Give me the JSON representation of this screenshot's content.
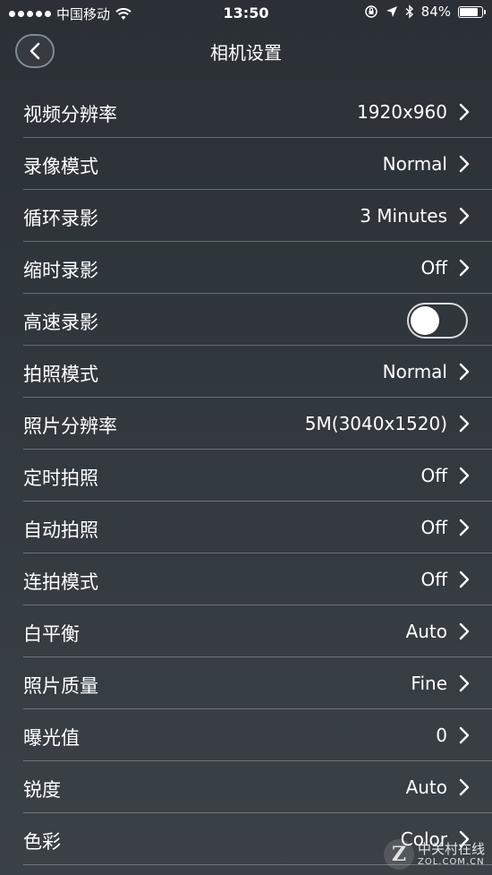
{
  "status_bar": {
    "carrier": "中国移动",
    "time": "13:50",
    "battery": "84%",
    "battery_level": 0.84
  },
  "header": {
    "title": "相机设置"
  },
  "settings": [
    {
      "label": "视频分辨率",
      "value": "1920x960"
    },
    {
      "label": "录像模式",
      "value": "Normal"
    },
    {
      "label": "循环录影",
      "value": "3 Minutes"
    },
    {
      "label": "缩时录影",
      "value": "Off"
    },
    {
      "label": "高速录影",
      "toggle": false
    },
    {
      "label": "拍照模式",
      "value": "Normal"
    },
    {
      "label": "照片分辨率",
      "value": "5M(3040x1520)"
    },
    {
      "label": "定时拍照",
      "value": "Off"
    },
    {
      "label": "自动拍照",
      "value": "Off"
    },
    {
      "label": "连拍模式",
      "value": "Off"
    },
    {
      "label": "白平衡",
      "value": "Auto"
    },
    {
      "label": "照片质量",
      "value": "Fine"
    },
    {
      "label": "曝光值",
      "value": "0"
    },
    {
      "label": "锐度",
      "value": "Auto"
    },
    {
      "label": "色彩",
      "value": "Color"
    }
  ],
  "watermark": {
    "cn": "中关村在线",
    "en": "ZOL.COM.CN"
  }
}
